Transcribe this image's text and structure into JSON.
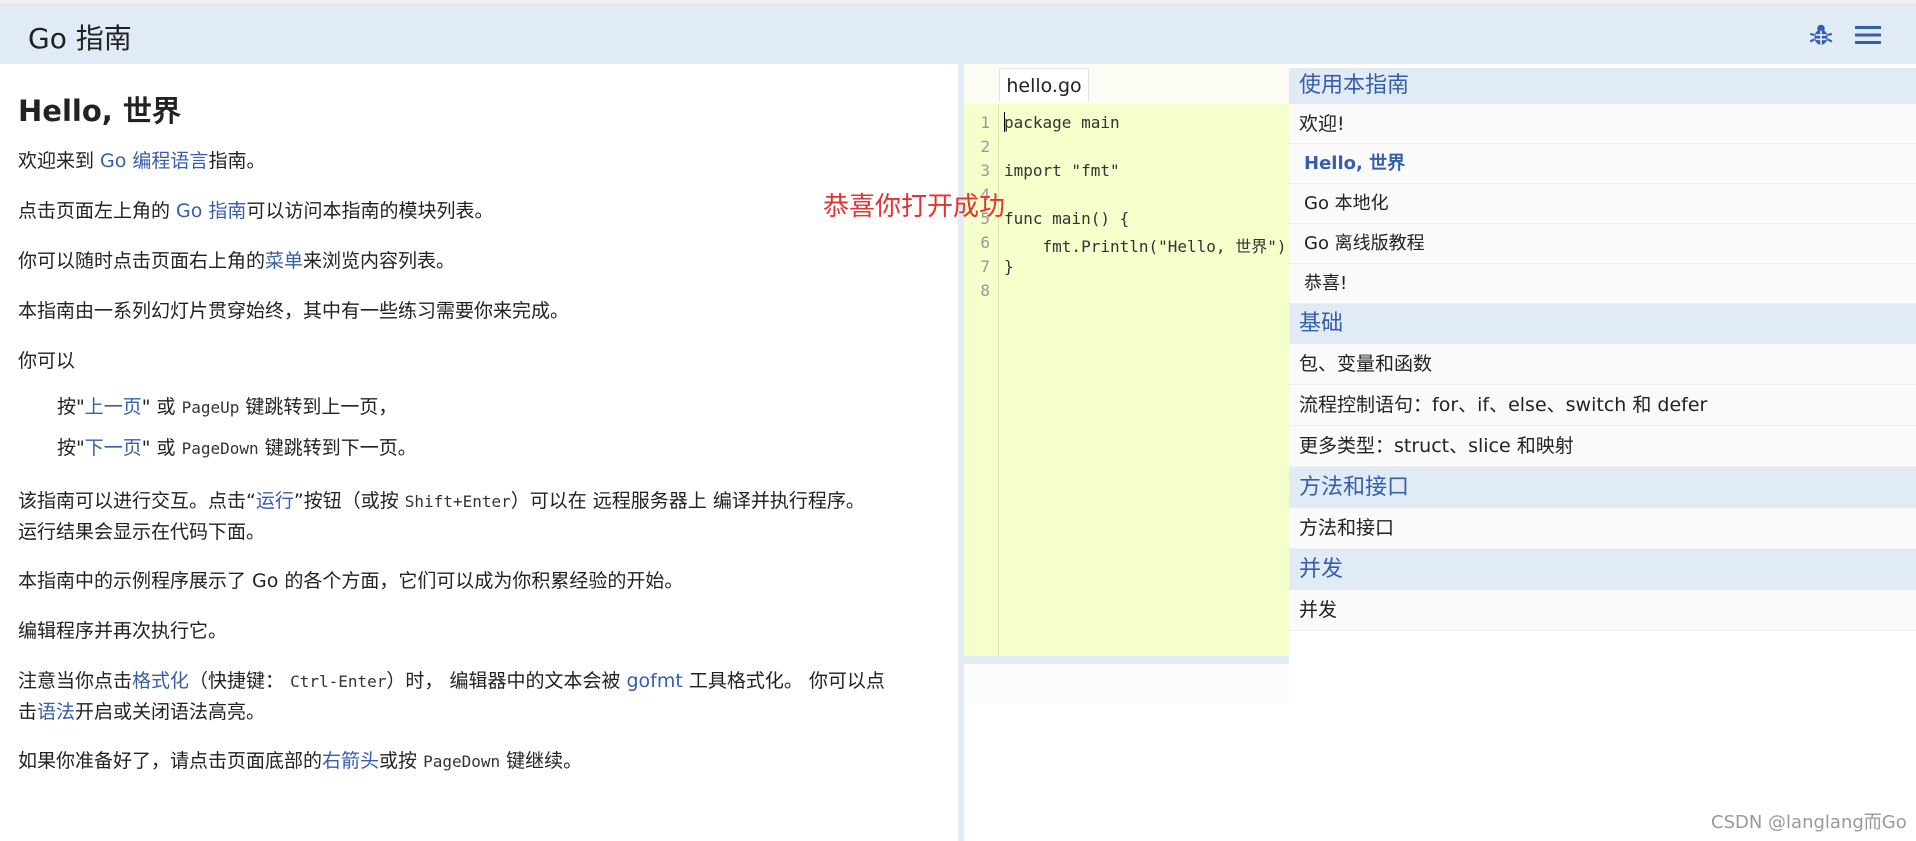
{
  "header": {
    "brand": "Go 指南",
    "icons": [
      "bug-icon",
      "menu-icon"
    ]
  },
  "lesson": {
    "title": "Hello, 世界",
    "p1": {
      "pre": "欢迎来到 ",
      "link": "Go 编程语言",
      "post": "指南。"
    },
    "p2": {
      "pre": "点击页面左上角的 ",
      "link": "Go 指南",
      "post": "可以访问本指南的模块列表。"
    },
    "p3": {
      "pre": "你可以随时点击页面右上角的",
      "link": "菜单",
      "post": "来浏览内容列表。"
    },
    "p4": "本指南由一系列幻灯片贯穿始终，其中有一些练习需要你来完成。",
    "p5": "你可以",
    "b1": {
      "pre": "按\"",
      "link": "上一页",
      "mid": "\" 或 ",
      "key": "PageUp",
      "post": " 键跳转到上一页，"
    },
    "b2": {
      "pre": "按\"",
      "link": "下一页",
      "mid": "\" 或 ",
      "key": "PageDown",
      "post": " 键跳转到下一页。"
    },
    "p6": {
      "pre": "该指南可以进行交互。点击“",
      "link": "运行",
      "mid": "”按钮（或按 ",
      "key": "Shift+Enter",
      "post": "）可以在 远程服务器上 编译并执行程序。",
      "line2": "运行结果会显示在代码下面。"
    },
    "p7": "本指南中的示例程序展示了 Go 的各个方面，它们可以成为你积累经验的开始。",
    "p8": "编辑程序并再次执行它。",
    "p9": {
      "pre": "注意当你点击",
      "link": "格式化",
      "mid": "（快捷键： ",
      "key": "Ctrl-Enter",
      "mid2": "）时， 编辑器中的文本会被 ",
      "link2": "gofmt",
      "post": " 工具格式化。 你可以点",
      "line2pre": "击",
      "link3": "语法",
      "line2post": "开启或关闭语法高亮。"
    },
    "p10": {
      "pre": "如果你准备好了，请点击页面底部的",
      "link": "右箭头",
      "mid": "或按 ",
      "key": "PageDown",
      "post": " 键继续。"
    }
  },
  "editor": {
    "file_tab": "hello.go",
    "line_numbers": [
      "1",
      "2",
      "3",
      "4",
      "5",
      "6",
      "7",
      "8"
    ],
    "lines": [
      "package main",
      "",
      "import \"fmt\"",
      "",
      "func main() {",
      "    fmt.Println(\"Hello, 世界\")",
      "}",
      ""
    ]
  },
  "toc": {
    "sections": [
      {
        "title": "使用本指南",
        "items": [
          "欢迎!",
          "Hello, 世界",
          "Go 本地化",
          "Go 离线版教程",
          "恭喜!"
        ]
      },
      {
        "title": "基础",
        "items": [
          "包、变量和函数",
          "流程控制语句：for、if、else、switch 和 defer",
          "更多类型：struct、slice 和映射"
        ]
      },
      {
        "title": "方法和接口",
        "items": [
          "方法和接口"
        ]
      },
      {
        "title": "并发",
        "items": [
          "并发"
        ]
      }
    ]
  },
  "overlay": "恭喜你打开成功",
  "watermark": "CSDN @langlang而Go"
}
